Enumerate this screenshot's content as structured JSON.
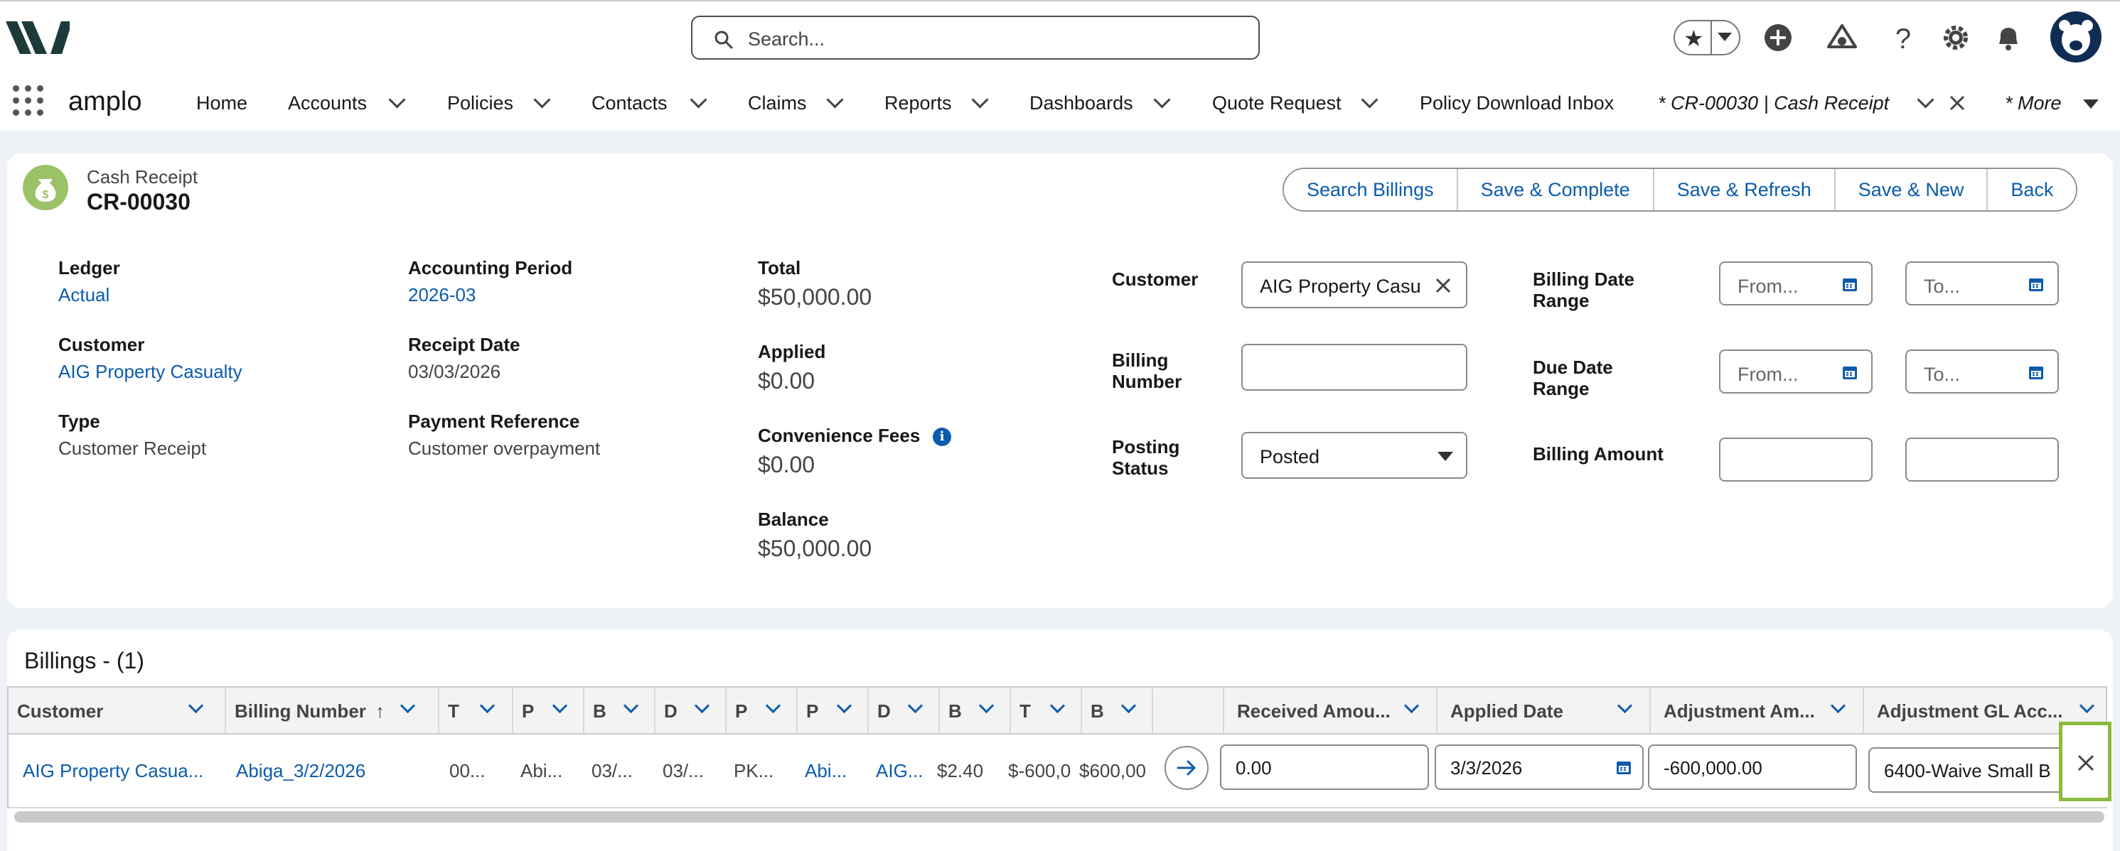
{
  "header": {
    "search_placeholder": "Search...",
    "app_name": "amplo",
    "nav_items": [
      {
        "label": "Home"
      },
      {
        "label": "Accounts"
      },
      {
        "label": "Policies"
      },
      {
        "label": "Contacts"
      },
      {
        "label": "Claims"
      },
      {
        "label": "Reports"
      },
      {
        "label": "Dashboards"
      },
      {
        "label": "Quote Request"
      },
      {
        "label": "Policy Download Inbox"
      }
    ],
    "active_tab": "* CR-00030 | Cash Receipt",
    "more_label": "* More"
  },
  "record": {
    "object_label": "Cash Receipt",
    "name": "CR-00030",
    "actions": [
      "Search Billings",
      "Save & Complete",
      "Save & Refresh",
      "Save & New",
      "Back"
    ],
    "fields": {
      "ledger_label": "Ledger",
      "ledger": "Actual",
      "period_label": "Accounting Period",
      "period": "2026-03",
      "customer_label": "Customer",
      "customer": "AIG Property Casualty",
      "receipt_date_label": "Receipt Date",
      "receipt_date": "03/03/2026",
      "type_label": "Type",
      "type": "Customer Receipt",
      "payment_ref_label": "Payment Reference",
      "payment_ref": "Customer overpayment",
      "total_label": "Total",
      "total": "$50,000.00",
      "applied_label": "Applied",
      "applied": "$0.00",
      "conv_fees_label": "Convenience Fees",
      "conv_fees": "$0.00",
      "balance_label": "Balance",
      "balance": "$50,000.00"
    },
    "filters": {
      "customer_label": "Customer",
      "customer_value": "AIG Property Casu",
      "billing_number_label": "Billing Number",
      "billing_number_value": "",
      "posting_status_label": "Posting Status",
      "posting_status_value": "Posted",
      "billing_date_label": "Billing Date Range",
      "due_date_label": "Due Date Range",
      "billing_amount_label": "Billing Amount",
      "from_placeholder": "From...",
      "to_placeholder": "To..."
    }
  },
  "billings": {
    "title": "Billings - (1)",
    "columns": [
      "Customer",
      "Billing Number",
      "T",
      "P",
      "B",
      "D",
      "P",
      "P",
      "D",
      "B",
      "T",
      "B",
      "",
      "Received Amou...",
      "Applied Date",
      "Adjustment Am...",
      "Adjustment GL Acc..."
    ],
    "sort_indicator": "↑",
    "rows": [
      {
        "customer": "AIG Property Casua...",
        "billing_number": "Abiga_3/2/2026",
        "c3": "00...",
        "c4": "Abi...",
        "c5": "03/...",
        "c6": "03/...",
        "c7": "PK...",
        "c8": "Abi...",
        "c9": "AIG...",
        "c10": "$2.40",
        "c11": "$-600,0",
        "c12": "$600,00",
        "received_amount": "0.00",
        "applied_date": "3/3/2026",
        "adjustment_amount": "-600,000.00",
        "adjustment_gl": "6400-Waive Small B"
      }
    ]
  },
  "colors": {
    "accent": "#0b5cab",
    "highlight": "#8bbb3b",
    "record_icon": "#9cc267"
  }
}
